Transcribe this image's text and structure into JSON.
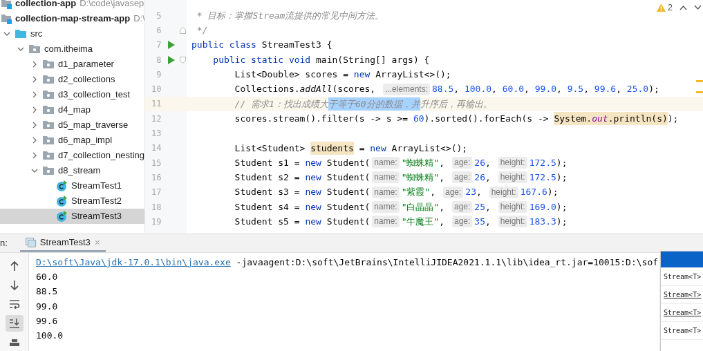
{
  "project_tree": [
    {
      "label": "collection-app",
      "path": "D:\\code\\javasep",
      "kind": "module",
      "selected": false
    },
    {
      "label": "collection-map-stream-app",
      "path": "D:\\",
      "kind": "module",
      "selected": false,
      "children": [
        {
          "label": "src",
          "kind": "source",
          "expanded": true,
          "selected": false,
          "children": [
            {
              "label": "com.itheima",
              "kind": "package",
              "expanded": true,
              "selected": false,
              "children": [
                {
                  "label": "d1_parameter",
                  "kind": "package",
                  "expanded": false,
                  "selected": false
                },
                {
                  "label": "d2_collections",
                  "kind": "package",
                  "expanded": false,
                  "selected": false
                },
                {
                  "label": "d3_collection_test",
                  "kind": "package",
                  "expanded": false,
                  "selected": false
                },
                {
                  "label": "d4_map",
                  "kind": "package",
                  "expanded": false,
                  "selected": false
                },
                {
                  "label": "d5_map_traverse",
                  "kind": "package",
                  "expanded": false,
                  "selected": false
                },
                {
                  "label": "d6_map_impl",
                  "kind": "package",
                  "expanded": false,
                  "selected": false
                },
                {
                  "label": "d7_collection_nesting",
                  "kind": "package",
                  "expanded": false,
                  "selected": false
                },
                {
                  "label": "d8_stream",
                  "kind": "package",
                  "expanded": true,
                  "selected": false,
                  "children": [
                    {
                      "label": "StreamTest1",
                      "kind": "class",
                      "selected": false
                    },
                    {
                      "label": "StreamTest2",
                      "kind": "class",
                      "selected": false
                    },
                    {
                      "label": "StreamTest3",
                      "kind": "class",
                      "selected": true
                    }
                  ]
                }
              ]
            }
          ]
        }
      ]
    }
  ],
  "editor": {
    "inspections": {
      "count": "2"
    },
    "lines": [
      {
        "number": "5",
        "run": false,
        "current": false,
        "tokens": [
          {
            "kind": "comment",
            "text": " * 目标：掌握Stream流提供的常见中间方法。"
          }
        ]
      },
      {
        "number": "6",
        "run": false,
        "fold_end": true,
        "current": false,
        "tokens": [
          {
            "kind": "comment",
            "text": " */"
          }
        ]
      },
      {
        "number": "7",
        "run": true,
        "current": false,
        "tokens": [
          {
            "kind": "keyword",
            "text": "public class "
          },
          {
            "kind": "text",
            "text": "StreamTest3 {"
          }
        ]
      },
      {
        "number": "8",
        "run": true,
        "fold_start": true,
        "current": false,
        "tokens": [
          {
            "kind": "keyword",
            "text": "    public static void "
          },
          {
            "kind": "text",
            "text": "main(String[] args) {"
          }
        ]
      },
      {
        "number": "9",
        "run": false,
        "current": false,
        "tokens": [
          {
            "kind": "text",
            "text": "        List<Double> scores = "
          },
          {
            "kind": "keyword",
            "text": "new "
          },
          {
            "kind": "text",
            "text": "ArrayList<>();"
          }
        ]
      },
      {
        "number": "10",
        "run": false,
        "current": false,
        "tokens": [
          {
            "kind": "text",
            "text": "        Collections."
          },
          {
            "kind": "method",
            "text": "addAll"
          },
          {
            "kind": "text",
            "text": "(scores, "
          },
          {
            "kind": "hint",
            "text": "...elements:"
          },
          {
            "kind": "number",
            "text": "88.5"
          },
          {
            "kind": "text",
            "text": ", "
          },
          {
            "kind": "number",
            "text": "100.0"
          },
          {
            "kind": "text",
            "text": ", "
          },
          {
            "kind": "number",
            "text": "60.0"
          },
          {
            "kind": "text",
            "text": ", "
          },
          {
            "kind": "number",
            "text": "99.0"
          },
          {
            "kind": "text",
            "text": ", "
          },
          {
            "kind": "number",
            "text": "9.5"
          },
          {
            "kind": "text",
            "text": ", "
          },
          {
            "kind": "number",
            "text": "99.6"
          },
          {
            "kind": "text",
            "text": ", "
          },
          {
            "kind": "number",
            "text": "25.0"
          },
          {
            "kind": "text",
            "text": ");"
          }
        ]
      },
      {
        "number": "11",
        "run": false,
        "current": true,
        "tokens": [
          {
            "kind": "comment",
            "text": "        // 需求1：找出成绩大"
          },
          {
            "kind": "selection",
            "text": "于等于60分的数据，并"
          },
          {
            "kind": "comment",
            "text": "升序后，再输出。"
          }
        ]
      },
      {
        "number": "12",
        "run": false,
        "current": false,
        "tokens": [
          {
            "kind": "text",
            "text": "        scores.stream().filter(s -> s >= "
          },
          {
            "kind": "number",
            "text": "60"
          },
          {
            "kind": "text",
            "text": ").sorted().forEach(s -> "
          },
          {
            "kind": "usage",
            "text": "System."
          },
          {
            "kind": "usage-field",
            "text": "out"
          },
          {
            "kind": "usage",
            "text": ".println(s)"
          },
          {
            "kind": "text",
            "text": ");"
          }
        ]
      },
      {
        "number": "13",
        "run": false,
        "current": false
      },
      {
        "number": "14",
        "run": false,
        "current": false,
        "tokens": [
          {
            "kind": "text",
            "text": "        List<Student> "
          },
          {
            "kind": "usage",
            "text": "students"
          },
          {
            "kind": "text",
            "text": " = "
          },
          {
            "kind": "keyword",
            "text": "new "
          },
          {
            "kind": "text",
            "text": "ArrayList<>();"
          }
        ]
      },
      {
        "number": "15",
        "run": false,
        "current": false,
        "tokens": [
          {
            "kind": "text",
            "text": "        Student s1 = "
          },
          {
            "kind": "keyword",
            "text": "new "
          },
          {
            "kind": "text",
            "text": "Student("
          },
          {
            "kind": "hint",
            "text": "name:"
          },
          {
            "kind": "string",
            "text": "\"蜘蛛精\""
          },
          {
            "kind": "text",
            "text": ", "
          },
          {
            "kind": "hint",
            "text": "age:"
          },
          {
            "kind": "number",
            "text": "26"
          },
          {
            "kind": "text",
            "text": ", "
          },
          {
            "kind": "hint",
            "text": "height:"
          },
          {
            "kind": "number",
            "text": "172.5"
          },
          {
            "kind": "text",
            "text": ");"
          }
        ]
      },
      {
        "number": "16",
        "run": false,
        "current": false,
        "tokens": [
          {
            "kind": "text",
            "text": "        Student s2 = "
          },
          {
            "kind": "keyword",
            "text": "new "
          },
          {
            "kind": "text",
            "text": "Student("
          },
          {
            "kind": "hint",
            "text": "name:"
          },
          {
            "kind": "string",
            "text": "\"蜘蛛精\""
          },
          {
            "kind": "text",
            "text": ", "
          },
          {
            "kind": "hint",
            "text": "age:"
          },
          {
            "kind": "number",
            "text": "26"
          },
          {
            "kind": "text",
            "text": ", "
          },
          {
            "kind": "hint",
            "text": "height:"
          },
          {
            "kind": "number",
            "text": "172.5"
          },
          {
            "kind": "text",
            "text": ");"
          }
        ]
      },
      {
        "number": "17",
        "run": false,
        "current": false,
        "tokens": [
          {
            "kind": "text",
            "text": "        Student s3 = "
          },
          {
            "kind": "keyword",
            "text": "new "
          },
          {
            "kind": "text",
            "text": "Student("
          },
          {
            "kind": "hint",
            "text": "name:"
          },
          {
            "kind": "string",
            "text": "\"紫霞\""
          },
          {
            "kind": "text",
            "text": ", "
          },
          {
            "kind": "hint",
            "text": "age:"
          },
          {
            "kind": "number",
            "text": "23"
          },
          {
            "kind": "text",
            "text": ", "
          },
          {
            "kind": "hint",
            "text": "height:"
          },
          {
            "kind": "number",
            "text": "167.6"
          },
          {
            "kind": "text",
            "text": ");"
          }
        ]
      },
      {
        "number": "18",
        "run": false,
        "current": false,
        "tokens": [
          {
            "kind": "text",
            "text": "        Student s4 = "
          },
          {
            "kind": "keyword",
            "text": "new "
          },
          {
            "kind": "text",
            "text": "Student("
          },
          {
            "kind": "hint",
            "text": "name:"
          },
          {
            "kind": "string",
            "text": "\"白晶晶\""
          },
          {
            "kind": "text",
            "text": ", "
          },
          {
            "kind": "hint",
            "text": "age:"
          },
          {
            "kind": "number",
            "text": "25"
          },
          {
            "kind": "text",
            "text": ", "
          },
          {
            "kind": "hint",
            "text": "height:"
          },
          {
            "kind": "number",
            "text": "169.0"
          },
          {
            "kind": "text",
            "text": ");"
          }
        ]
      },
      {
        "number": "19",
        "run": false,
        "current": false,
        "tokens": [
          {
            "kind": "text",
            "text": "        Student s5 = "
          },
          {
            "kind": "keyword",
            "text": "new "
          },
          {
            "kind": "text",
            "text": "Student("
          },
          {
            "kind": "hint",
            "text": "name:"
          },
          {
            "kind": "string",
            "text": "\"牛魔王\""
          },
          {
            "kind": "text",
            "text": ", "
          },
          {
            "kind": "hint",
            "text": "age:"
          },
          {
            "kind": "number",
            "text": "35"
          },
          {
            "kind": "text",
            "text": ", "
          },
          {
            "kind": "hint",
            "text": "height:"
          },
          {
            "kind": "number",
            "text": "183.3"
          },
          {
            "kind": "text",
            "text": ");"
          }
        ]
      }
    ]
  },
  "run_panel": {
    "label": "n:",
    "tabs": [
      {
        "label": "StreamTest3",
        "close": "×",
        "selected": true
      }
    ],
    "toolbar": [
      {
        "kind": "up",
        "selected": false
      },
      {
        "kind": "down",
        "selected": false
      },
      {
        "kind": "wrap",
        "selected": false
      },
      {
        "kind": "scroll-end",
        "selected": true
      },
      {
        "kind": "print",
        "selected": false
      }
    ],
    "console": [
      {
        "tokens": [
          {
            "kind": "link",
            "text": "D:\\soft\\Java\\jdk-17.0.1\\bin\\java.exe"
          },
          {
            "kind": "text",
            "text": " -javaagent:D:\\soft\\JetBrains\\IntelliJIDEA2021.1.1\\lib\\idea_rt.jar=10015:D:\\sof"
          }
        ]
      },
      {
        "tokens": [
          {
            "kind": "text",
            "text": "60.0"
          }
        ]
      },
      {
        "tokens": [
          {
            "kind": "text",
            "text": "88.5"
          }
        ]
      },
      {
        "tokens": [
          {
            "kind": "text",
            "text": "99.0"
          }
        ]
      },
      {
        "tokens": [
          {
            "kind": "text",
            "text": "99.6"
          }
        ]
      },
      {
        "tokens": [
          {
            "kind": "text",
            "text": "100.0"
          }
        ]
      }
    ],
    "popup": {
      "items": [
        {
          "selected": true
        },
        {
          "text": "Stream<T>",
          "underlined": false,
          "selected": false
        },
        {
          "text": "Stream<T>",
          "underlined": true,
          "selected": false
        },
        {
          "text": "Stream<T>",
          "underlined": true,
          "selected": false
        },
        {
          "text": "Stream<T>",
          "underlined": false,
          "selected": false
        }
      ]
    }
  }
}
